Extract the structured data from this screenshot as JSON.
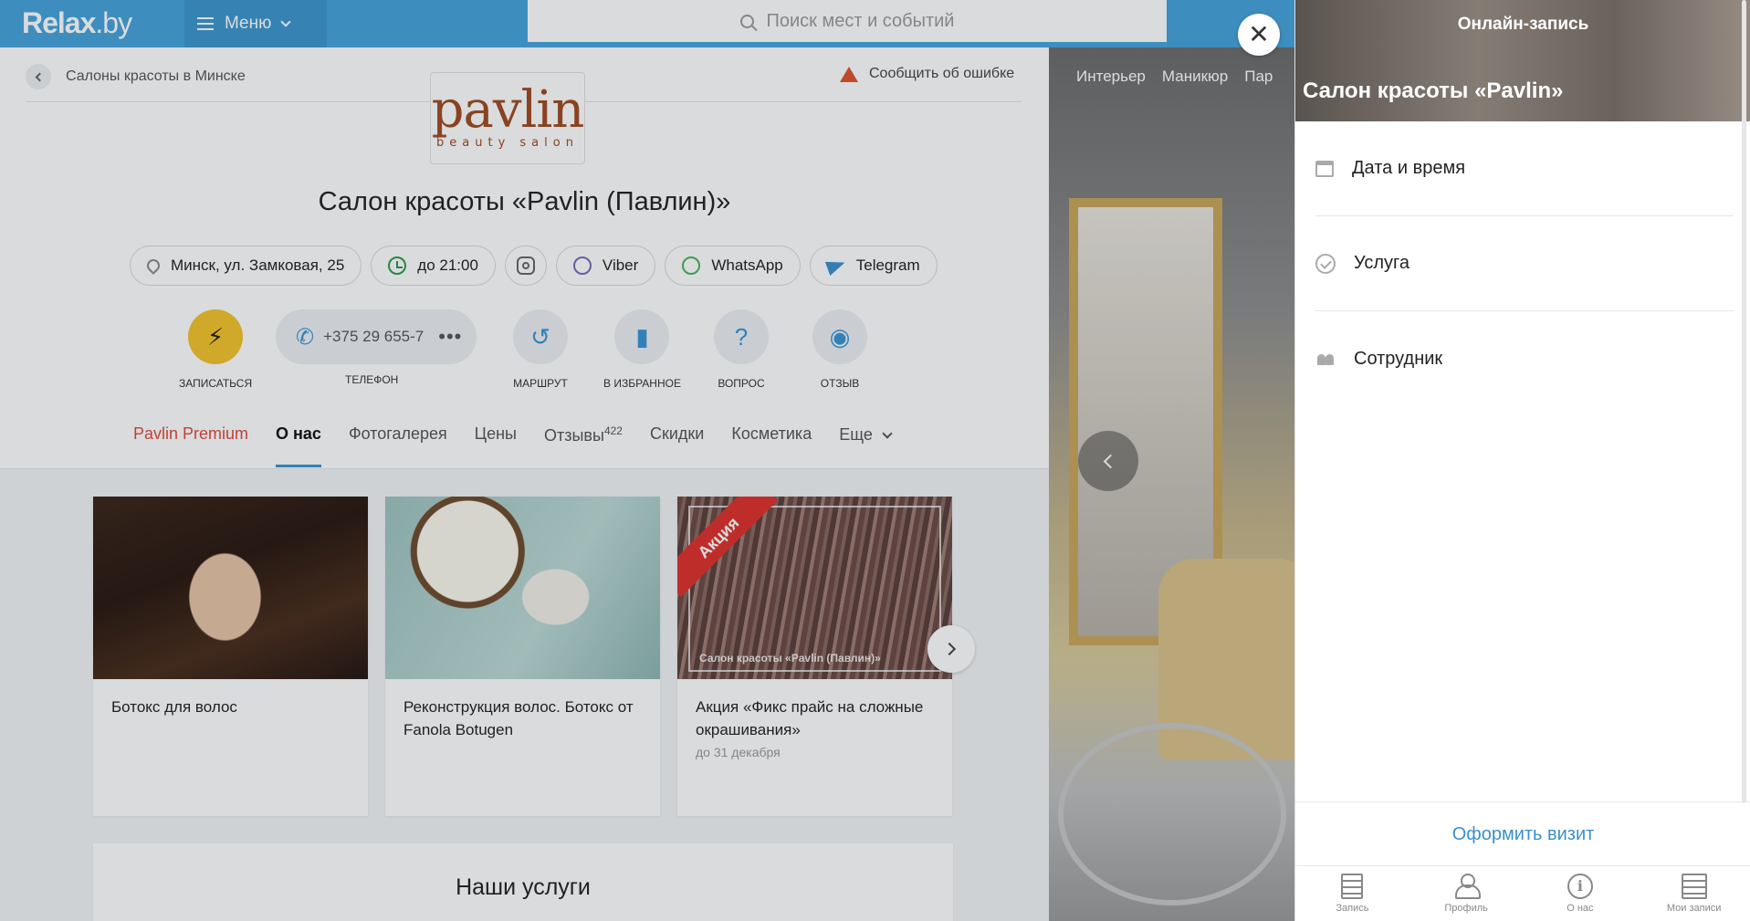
{
  "header": {
    "logo_main": "Relax",
    "logo_tld": ".by",
    "menu_label": "Меню",
    "search_placeholder": "Поиск мест и событий"
  },
  "breadcrumb": {
    "label": "Салоны красоты в Минске"
  },
  "report_error": "Сообщить об ошибке",
  "brand": {
    "word": "pavlin",
    "tagline": "beauty salon"
  },
  "salon_title": "Салон красоты «Pavlin (Павлин)»",
  "chips": {
    "address": "Минск, ул. Замковая, 25",
    "hours": "до 21:00",
    "viber": "Viber",
    "whatsapp": "WhatsApp",
    "telegram": "Telegram"
  },
  "actions": {
    "book": "Записаться",
    "phone_number": "+375 29 655-7",
    "phone_label": "Телефон",
    "route": "Маршрут",
    "favorite": "В избранное",
    "question": "Вопрос",
    "review": "Отзыв"
  },
  "tabs": [
    {
      "label": "Pavlin Premium"
    },
    {
      "label": "О нас"
    },
    {
      "label": "Фотогалерея"
    },
    {
      "label": "Цены"
    },
    {
      "label": "Отзывы",
      "count": "422"
    },
    {
      "label": "Скидки"
    },
    {
      "label": "Косметика"
    },
    {
      "label": "Еще"
    }
  ],
  "cards": [
    {
      "title": "Ботокс для волос",
      "note": ""
    },
    {
      "title": "Реконструкция волос. Ботокс от Fanola Botugen",
      "note": ""
    },
    {
      "title": "Акция «Фикс прайс на сложные окрашивания»",
      "note": "до 31 декабря",
      "ribbon": "Акция",
      "caption": "Салон красоты «Pavlin (Павлин)»"
    }
  ],
  "services_heading": "Наши услуги",
  "gallery": {
    "tabs": [
      "Интерьер",
      "Маникюр",
      "Пар"
    ]
  },
  "booking": {
    "kicker": "Онлайн-запись",
    "salon_name": "Салон красоты «Pavlin»",
    "steps": [
      {
        "label": "Дата и время",
        "icon": "calendar-icon"
      },
      {
        "label": "Услуга",
        "icon": "check-circle-icon"
      },
      {
        "label": "Сотрудник",
        "icon": "people-icon"
      }
    ],
    "submit": "Оформить визит",
    "nav": [
      {
        "label": "Запись",
        "icon": "booking-icon"
      },
      {
        "label": "Профиль",
        "icon": "profile-icon"
      },
      {
        "label": "О нас",
        "icon": "info-icon"
      },
      {
        "label": "Мои записи",
        "icon": "list-icon"
      }
    ]
  },
  "colors": {
    "header_blue": "#46a4dd",
    "accent_blue": "#3794d6",
    "book_yellow": "#f5c32b",
    "premium_red": "#e0493c",
    "promo_red": "#e0302c"
  }
}
